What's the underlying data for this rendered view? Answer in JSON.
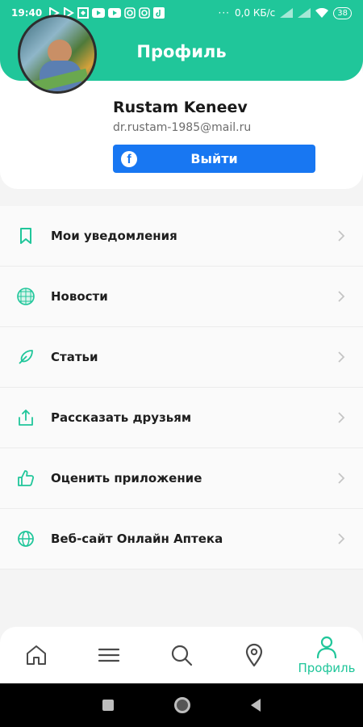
{
  "status_bar": {
    "time": "19:40",
    "net_speed": "0,0 КБ/с",
    "battery": "38"
  },
  "header": {
    "title": "Профиль"
  },
  "profile": {
    "name": "Rustam Keneev",
    "email": "dr.rustam-1985@mail.ru",
    "logout_label": "Выйти",
    "facebook_glyph": "f"
  },
  "menu": {
    "items": [
      {
        "label": "Мои уведомления",
        "icon": "bookmark-icon"
      },
      {
        "label": "Новости",
        "icon": "globe-grid-icon"
      },
      {
        "label": "Статьи",
        "icon": "feather-icon"
      },
      {
        "label": "Рассказать друзьям",
        "icon": "share-icon"
      },
      {
        "label": "Оценить приложение",
        "icon": "thumbs-up-icon"
      },
      {
        "label": "Веб-сайт Онлайн Аптека",
        "icon": "globe-icon"
      }
    ]
  },
  "bottom_nav": {
    "items": [
      {
        "icon": "home-icon"
      },
      {
        "icon": "menu-icon"
      },
      {
        "icon": "search-icon"
      },
      {
        "icon": "location-icon"
      },
      {
        "icon": "user-icon",
        "label": "Профиль",
        "active": true
      }
    ]
  },
  "colors": {
    "accent": "#20c69a",
    "facebook": "#1877f2"
  }
}
